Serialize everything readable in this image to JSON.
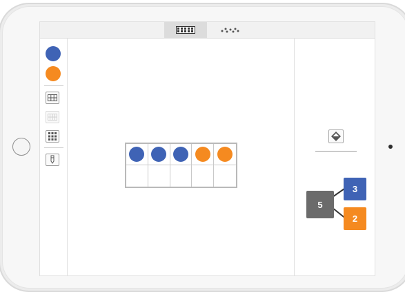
{
  "toolbar": {
    "modes": [
      {
        "name": "ten-frame-mode-icon",
        "active": true
      },
      {
        "name": "dot-pattern-mode-icon",
        "active": false
      }
    ]
  },
  "sidebar": {
    "colors": [
      {
        "name": "blue-counter-swatch",
        "color": "#3f63b5"
      },
      {
        "name": "orange-counter-swatch",
        "color": "#f58a20"
      }
    ],
    "tools": [
      {
        "name": "ten-frame-grid-icon",
        "enabled": true
      },
      {
        "name": "double-grid-icon",
        "enabled": false
      },
      {
        "name": "dot-grid-icon",
        "enabled": true
      },
      {
        "name": "pencil-icon",
        "enabled": true
      }
    ]
  },
  "ten_frame": {
    "cells": [
      "blue",
      "blue",
      "blue",
      "orange",
      "orange",
      "empty",
      "empty",
      "empty",
      "empty",
      "empty"
    ]
  },
  "number_bond": {
    "whole": "5",
    "part_top": "3",
    "part_bottom": "2"
  },
  "colors": {
    "blue": "#3f63b5",
    "orange": "#f58a20",
    "whole_box": "#6b6b6b"
  }
}
